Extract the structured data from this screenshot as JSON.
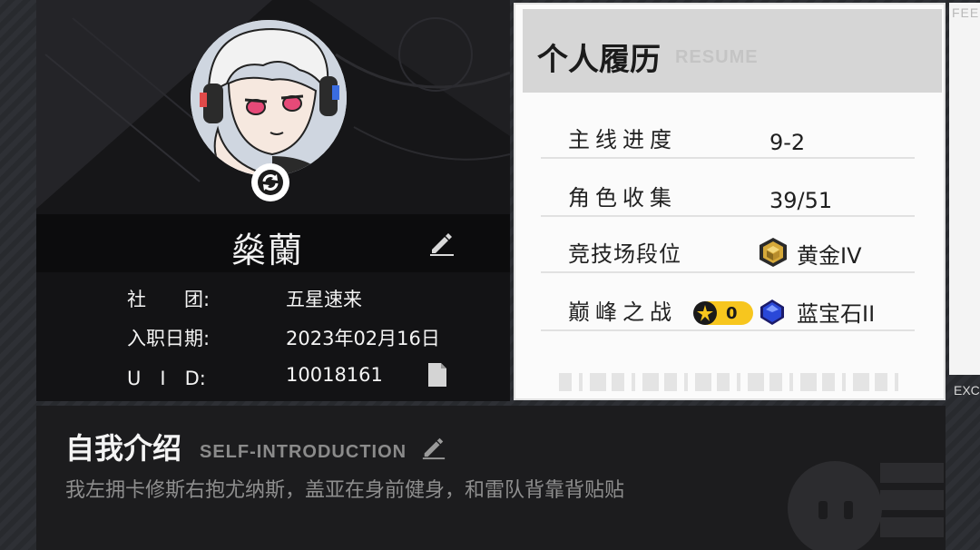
{
  "profile": {
    "name": "燊蘭",
    "club_label": "社　　团:",
    "club_value": "五星速来",
    "join_label": "入职日期:",
    "join_value": "2023年02月16日",
    "uid_label": "U　I　D:",
    "uid_value": "10018161"
  },
  "resume": {
    "title": "个人履历",
    "subtitle": "RESUME",
    "rows": [
      {
        "label": "主线进度",
        "value": "9-2"
      },
      {
        "label": "角色收集",
        "value": "39/51"
      },
      {
        "label": "竞技场段位",
        "value": "黄金IV",
        "icon": "gold-rank-icon"
      },
      {
        "label": "巅峰之战",
        "badge": "0",
        "value": "蓝宝石II",
        "icon": "sapphire-rank-icon"
      }
    ]
  },
  "side": {
    "top_label": "FEE",
    "bottom_label": "EXC"
  },
  "intro": {
    "title": "自我介绍",
    "subtitle": "SELF-INTRODUCTION",
    "text": "我左拥卡修斯右抱尤纳斯，盖亚在身前健身，和雷队背靠背贴贴"
  },
  "colors": {
    "background": "#2b2d31",
    "card_dark": "#1a1a1c",
    "resume_bg": "#fbfbfb",
    "badge_yellow": "#f7c61e",
    "sapphire": "#2340c8",
    "gold": "#c9a227"
  }
}
